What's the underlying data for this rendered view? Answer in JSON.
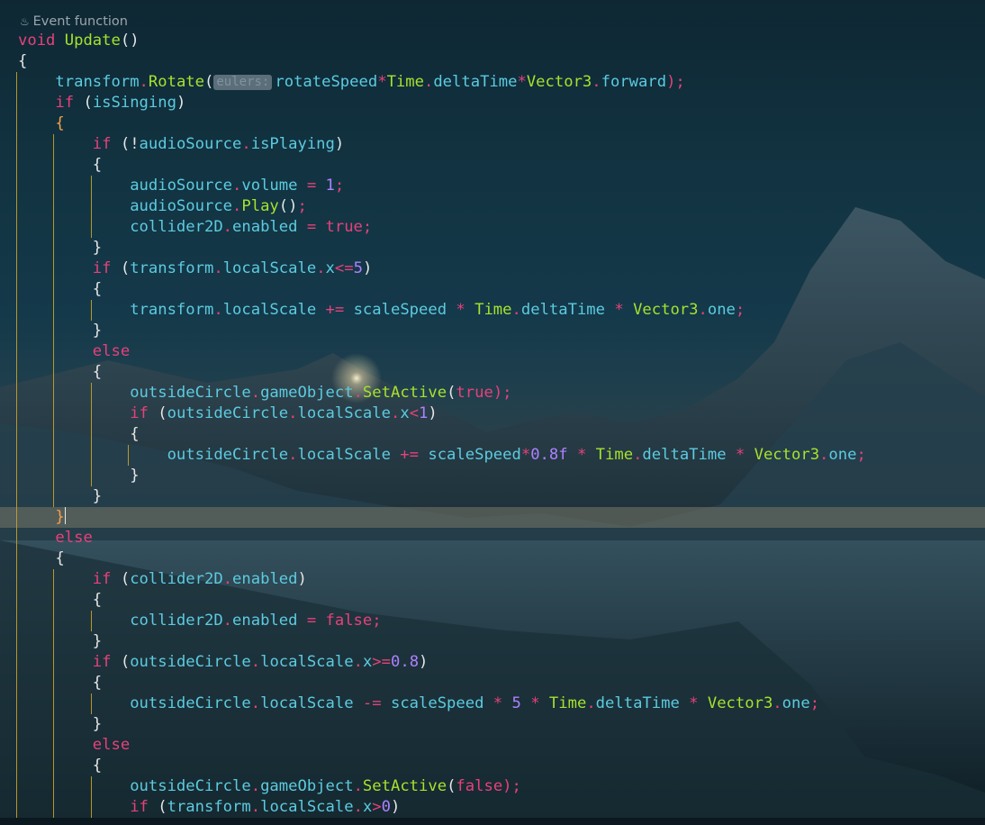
{
  "editor": {
    "codelens": {
      "icon": "flame-icon",
      "label": "Event function"
    },
    "inlay_hint": "eulers:",
    "lines": [
      [
        {
          "t": "void ",
          "c": "kw"
        },
        {
          "t": "Update",
          "c": "fn"
        },
        {
          "t": "()",
          "c": "pu"
        }
      ],
      [
        {
          "t": "{",
          "c": "pu"
        }
      ],
      [
        {
          "t": "    "
        },
        {
          "t": "transform",
          "c": "ty"
        },
        {
          "t": ".",
          "c": "op"
        },
        {
          "t": "Rotate",
          "c": "fn"
        },
        {
          "t": "(",
          "c": "pu"
        },
        {
          "hint": true
        },
        {
          "t": "rotateSpeed",
          "c": "ty"
        },
        {
          "t": "*",
          "c": "op"
        },
        {
          "t": "Time",
          "c": "fn"
        },
        {
          "t": ".",
          "c": "op"
        },
        {
          "t": "deltaTime",
          "c": "ty"
        },
        {
          "t": "*",
          "c": "op"
        },
        {
          "t": "Vector3",
          "c": "fn"
        },
        {
          "t": ".",
          "c": "op"
        },
        {
          "t": "forward",
          "c": "ty"
        },
        {
          "t": ");",
          "c": "op"
        }
      ],
      [
        {
          "t": "    "
        },
        {
          "t": "if ",
          "c": "kw"
        },
        {
          "t": "(",
          "c": "pu"
        },
        {
          "t": "isSinging",
          "c": "ty"
        },
        {
          "t": ")",
          "c": "pu"
        }
      ],
      [
        {
          "t": "    "
        },
        {
          "t": "{",
          "c": "br"
        }
      ],
      [
        {
          "t": "        "
        },
        {
          "t": "if ",
          "c": "kw"
        },
        {
          "t": "(!",
          "c": "pu"
        },
        {
          "t": "audioSource",
          "c": "ty"
        },
        {
          "t": ".",
          "c": "op"
        },
        {
          "t": "isPlaying",
          "c": "ty"
        },
        {
          "t": ")",
          "c": "pu"
        }
      ],
      [
        {
          "t": "        "
        },
        {
          "t": "{",
          "c": "pu"
        }
      ],
      [
        {
          "t": "            "
        },
        {
          "t": "audioSource",
          "c": "ty"
        },
        {
          "t": ".",
          "c": "op"
        },
        {
          "t": "volume",
          "c": "ty"
        },
        {
          "t": " = ",
          "c": "op"
        },
        {
          "t": "1",
          "c": "num"
        },
        {
          "t": ";",
          "c": "op"
        }
      ],
      [
        {
          "t": "            "
        },
        {
          "t": "audioSource",
          "c": "ty"
        },
        {
          "t": ".",
          "c": "op"
        },
        {
          "t": "Play",
          "c": "fn"
        },
        {
          "t": "()",
          "c": "pu"
        },
        {
          "t": ";",
          "c": "op"
        }
      ],
      [
        {
          "t": "            "
        },
        {
          "t": "collider2D",
          "c": "ty"
        },
        {
          "t": ".",
          "c": "op"
        },
        {
          "t": "enabled",
          "c": "ty"
        },
        {
          "t": " = ",
          "c": "op"
        },
        {
          "t": "true",
          "c": "kw"
        },
        {
          "t": ";",
          "c": "op"
        }
      ],
      [
        {
          "t": "        "
        },
        {
          "t": "}",
          "c": "pu"
        }
      ],
      [
        {
          "t": "        "
        },
        {
          "t": "if ",
          "c": "kw"
        },
        {
          "t": "(",
          "c": "pu"
        },
        {
          "t": "transform",
          "c": "ty"
        },
        {
          "t": ".",
          "c": "op"
        },
        {
          "t": "localScale",
          "c": "ty"
        },
        {
          "t": ".",
          "c": "op"
        },
        {
          "t": "x",
          "c": "ty"
        },
        {
          "t": "<=",
          "c": "op"
        },
        {
          "t": "5",
          "c": "num"
        },
        {
          "t": ")",
          "c": "pu"
        }
      ],
      [
        {
          "t": "        "
        },
        {
          "t": "{",
          "c": "pu"
        }
      ],
      [
        {
          "t": "            "
        },
        {
          "t": "transform",
          "c": "ty"
        },
        {
          "t": ".",
          "c": "op"
        },
        {
          "t": "localScale",
          "c": "ty"
        },
        {
          "t": " += ",
          "c": "op"
        },
        {
          "t": "scaleSpeed",
          "c": "ty"
        },
        {
          "t": " * ",
          "c": "op"
        },
        {
          "t": "Time",
          "c": "fn"
        },
        {
          "t": ".",
          "c": "op"
        },
        {
          "t": "deltaTime",
          "c": "ty"
        },
        {
          "t": " * ",
          "c": "op"
        },
        {
          "t": "Vector3",
          "c": "fn"
        },
        {
          "t": ".",
          "c": "op"
        },
        {
          "t": "one",
          "c": "ty"
        },
        {
          "t": ";",
          "c": "op"
        }
      ],
      [
        {
          "t": "        "
        },
        {
          "t": "}",
          "c": "pu"
        }
      ],
      [
        {
          "t": "        "
        },
        {
          "t": "else",
          "c": "kw"
        }
      ],
      [
        {
          "t": "        "
        },
        {
          "t": "{",
          "c": "pu"
        }
      ],
      [
        {
          "t": "            "
        },
        {
          "t": "outsideCircle",
          "c": "ty"
        },
        {
          "t": ".",
          "c": "op"
        },
        {
          "t": "gameObject",
          "c": "ty"
        },
        {
          "t": ".",
          "c": "op"
        },
        {
          "t": "SetActive",
          "c": "fn"
        },
        {
          "t": "(",
          "c": "pu"
        },
        {
          "t": "true",
          "c": "kw"
        },
        {
          "t": ");",
          "c": "op"
        }
      ],
      [
        {
          "t": "            "
        },
        {
          "t": "if ",
          "c": "kw"
        },
        {
          "t": "(",
          "c": "pu"
        },
        {
          "t": "outsideCircle",
          "c": "ty"
        },
        {
          "t": ".",
          "c": "op"
        },
        {
          "t": "localScale",
          "c": "ty"
        },
        {
          "t": ".",
          "c": "op"
        },
        {
          "t": "x",
          "c": "ty"
        },
        {
          "t": "<",
          "c": "op"
        },
        {
          "t": "1",
          "c": "num"
        },
        {
          "t": ")",
          "c": "pu"
        }
      ],
      [
        {
          "t": "            "
        },
        {
          "t": "{",
          "c": "pu"
        }
      ],
      [
        {
          "t": "                "
        },
        {
          "t": "outsideCircle",
          "c": "ty"
        },
        {
          "t": ".",
          "c": "op"
        },
        {
          "t": "localScale",
          "c": "ty"
        },
        {
          "t": " += ",
          "c": "op"
        },
        {
          "t": "scaleSpeed",
          "c": "ty"
        },
        {
          "t": "*",
          "c": "op"
        },
        {
          "t": "0.8f",
          "c": "num"
        },
        {
          "t": " * ",
          "c": "op"
        },
        {
          "t": "Time",
          "c": "fn"
        },
        {
          "t": ".",
          "c": "op"
        },
        {
          "t": "deltaTime",
          "c": "ty"
        },
        {
          "t": " * ",
          "c": "op"
        },
        {
          "t": "Vector3",
          "c": "fn"
        },
        {
          "t": ".",
          "c": "op"
        },
        {
          "t": "one",
          "c": "ty"
        },
        {
          "t": ";",
          "c": "op"
        }
      ],
      [
        {
          "t": "            "
        },
        {
          "t": "}",
          "c": "pu"
        }
      ],
      [
        {
          "t": "        "
        },
        {
          "t": "}",
          "c": "pu"
        }
      ],
      [
        {
          "t": "    "
        },
        {
          "t": "}",
          "c": "br"
        },
        {
          "caret": true
        }
      ],
      [
        {
          "t": "    "
        },
        {
          "t": "else",
          "c": "kw"
        }
      ],
      [
        {
          "t": "    "
        },
        {
          "t": "{",
          "c": "pu"
        }
      ],
      [
        {
          "t": "        "
        },
        {
          "t": "if ",
          "c": "kw"
        },
        {
          "t": "(",
          "c": "pu"
        },
        {
          "t": "collider2D",
          "c": "ty"
        },
        {
          "t": ".",
          "c": "op"
        },
        {
          "t": "enabled",
          "c": "ty"
        },
        {
          "t": ")",
          "c": "pu"
        }
      ],
      [
        {
          "t": "        "
        },
        {
          "t": "{",
          "c": "pu"
        }
      ],
      [
        {
          "t": "            "
        },
        {
          "t": "collider2D",
          "c": "ty"
        },
        {
          "t": ".",
          "c": "op"
        },
        {
          "t": "enabled",
          "c": "ty"
        },
        {
          "t": " = ",
          "c": "op"
        },
        {
          "t": "false",
          "c": "kw"
        },
        {
          "t": ";",
          "c": "op"
        }
      ],
      [
        {
          "t": "        "
        },
        {
          "t": "}",
          "c": "pu"
        }
      ],
      [
        {
          "t": "        "
        },
        {
          "t": "if ",
          "c": "kw"
        },
        {
          "t": "(",
          "c": "pu"
        },
        {
          "t": "outsideCircle",
          "c": "ty"
        },
        {
          "t": ".",
          "c": "op"
        },
        {
          "t": "localScale",
          "c": "ty"
        },
        {
          "t": ".",
          "c": "op"
        },
        {
          "t": "x",
          "c": "ty"
        },
        {
          "t": ">=",
          "c": "op"
        },
        {
          "t": "0.8",
          "c": "num"
        },
        {
          "t": ")",
          "c": "pu"
        }
      ],
      [
        {
          "t": "        "
        },
        {
          "t": "{",
          "c": "pu"
        }
      ],
      [
        {
          "t": "            "
        },
        {
          "t": "outsideCircle",
          "c": "ty"
        },
        {
          "t": ".",
          "c": "op"
        },
        {
          "t": "localScale",
          "c": "ty"
        },
        {
          "t": " -= ",
          "c": "op"
        },
        {
          "t": "scaleSpeed",
          "c": "ty"
        },
        {
          "t": " * ",
          "c": "op"
        },
        {
          "t": "5",
          "c": "num"
        },
        {
          "t": " * ",
          "c": "op"
        },
        {
          "t": "Time",
          "c": "fn"
        },
        {
          "t": ".",
          "c": "op"
        },
        {
          "t": "deltaTime",
          "c": "ty"
        },
        {
          "t": " * ",
          "c": "op"
        },
        {
          "t": "Vector3",
          "c": "fn"
        },
        {
          "t": ".",
          "c": "op"
        },
        {
          "t": "one",
          "c": "ty"
        },
        {
          "t": ";",
          "c": "op"
        }
      ],
      [
        {
          "t": "        "
        },
        {
          "t": "}",
          "c": "pu"
        }
      ],
      [
        {
          "t": "        "
        },
        {
          "t": "else",
          "c": "kw"
        }
      ],
      [
        {
          "t": "        "
        },
        {
          "t": "{",
          "c": "pu"
        }
      ],
      [
        {
          "t": "            "
        },
        {
          "t": "outsideCircle",
          "c": "ty"
        },
        {
          "t": ".",
          "c": "op"
        },
        {
          "t": "gameObject",
          "c": "ty"
        },
        {
          "t": ".",
          "c": "op"
        },
        {
          "t": "SetActive",
          "c": "fn"
        },
        {
          "t": "(",
          "c": "pu"
        },
        {
          "t": "false",
          "c": "kw"
        },
        {
          "t": ");",
          "c": "op"
        }
      ],
      [
        {
          "t": "            "
        },
        {
          "t": "if ",
          "c": "kw"
        },
        {
          "t": "(",
          "c": "pu"
        },
        {
          "t": "transform",
          "c": "ty"
        },
        {
          "t": ".",
          "c": "op"
        },
        {
          "t": "localScale",
          "c": "ty"
        },
        {
          "t": ".",
          "c": "op"
        },
        {
          "t": "x",
          "c": "ty"
        },
        {
          "t": ">",
          "c": "op"
        },
        {
          "t": "0",
          "c": "num"
        },
        {
          "t": ")",
          "c": "pu"
        }
      ]
    ]
  }
}
